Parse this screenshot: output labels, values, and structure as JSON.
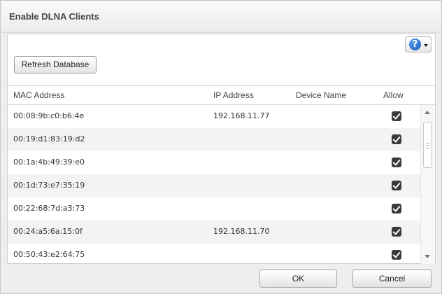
{
  "dialog": {
    "title": "Enable DLNA Clients",
    "refresh_label": "Refresh Database",
    "help_icon_glyph": "?",
    "ok_label": "OK",
    "cancel_label": "Cancel"
  },
  "table": {
    "columns": [
      "MAC Address",
      "IP Address",
      "Device Name",
      "Allow"
    ],
    "rows": [
      {
        "mac": "00:08:9b:c0:b6:4e",
        "ip": "192.168.11.77",
        "device": "",
        "allow": true
      },
      {
        "mac": "00:19:d1:83:19:d2",
        "ip": "",
        "device": "",
        "allow": true
      },
      {
        "mac": "00:1a:4b:49:39:e0",
        "ip": "",
        "device": "",
        "allow": true
      },
      {
        "mac": "00:1d:73:e7:35:19",
        "ip": "",
        "device": "",
        "allow": true
      },
      {
        "mac": "00:22:68:7d:a3:73",
        "ip": "",
        "device": "",
        "allow": true
      },
      {
        "mac": "00:24:a5:6a:15:0f",
        "ip": "192.168.11.70",
        "device": "",
        "allow": true
      },
      {
        "mac": "00:50:43:e2:64:75",
        "ip": "",
        "device": "",
        "allow": true
      }
    ]
  },
  "colors": {
    "accent": "#1456b8",
    "checkbox": "#3a3a3a",
    "alt_row": "#f3f3f3"
  }
}
